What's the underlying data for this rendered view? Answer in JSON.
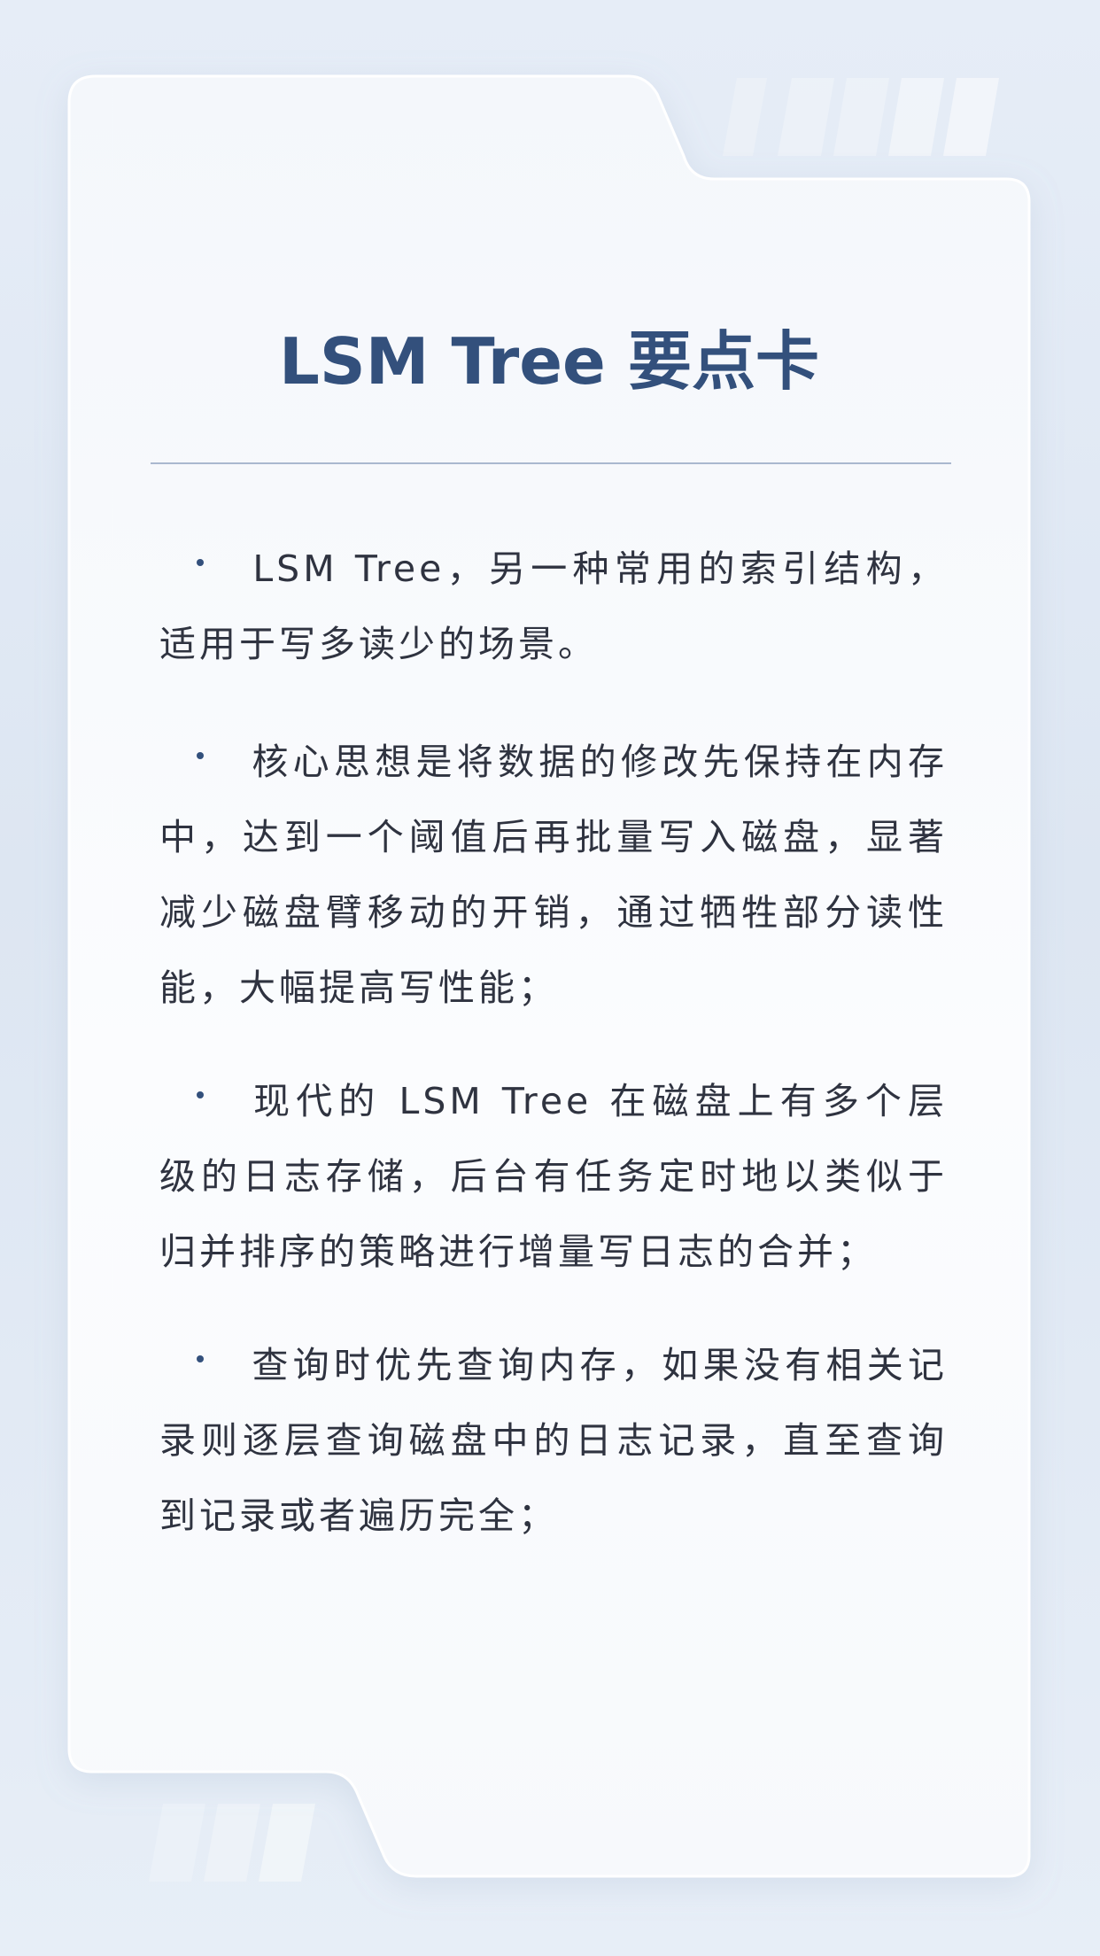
{
  "title": "LSM Tree 要点卡",
  "bullets": [
    "LSM Tree，另一种常用的索引结构，适用于写多读少的场景。",
    "核心思想是将数据的修改先保持在内存中，达到一个阈值后再批量写入磁盘，显著减少磁盘臂移动的开销，通过牺牲部分读性能，大幅提高写性能；",
    "现代的 LSM Tree 在磁盘上有多个层级的日志存储，后台有任务定时地以类似于归并排序的策略进行增量写日志的合并；",
    "查询时优先查询内存，如果没有相关记录则逐层查询磁盘中的日志记录，直至查询到记录或者遍历完全；"
  ]
}
